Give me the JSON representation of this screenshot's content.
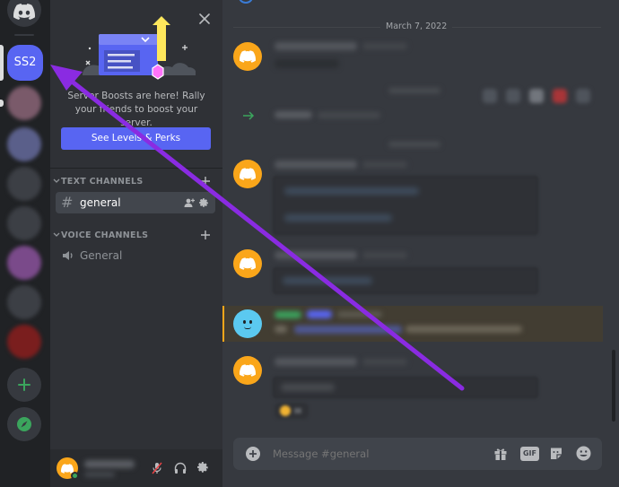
{
  "servers": {
    "active_label": "SS2",
    "home_tooltip": "Home"
  },
  "promo": {
    "text": "Server Boosts are here! Rally your friends to boost your server.",
    "button_label": "See Levels & Perks"
  },
  "channels": {
    "text_category": "TEXT CHANNELS",
    "voice_category": "VOICE CHANNELS",
    "text": [
      {
        "name": "general"
      }
    ],
    "voice": [
      {
        "name": "General"
      }
    ]
  },
  "chat": {
    "date_divider": "March 7, 2022",
    "input_placeholder": "Message #general",
    "gif_label": "GIF"
  },
  "colors": {
    "accent": "#5865f2",
    "boost_pink": "#ff73fa",
    "annotation_arrow": "#8a2be2",
    "avatar_orange": "#faa61a",
    "online_green": "#3ba55d"
  }
}
